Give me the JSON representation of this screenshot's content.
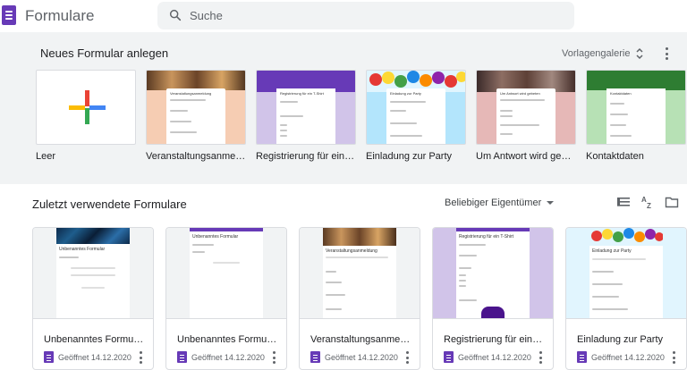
{
  "app": {
    "title": "Formulare",
    "logo_icon": "forms-logo-icon",
    "accent": "#673ab7"
  },
  "search": {
    "placeholder": "Suche"
  },
  "templates": {
    "title": "Neues Formular anlegen",
    "gallery_label": "Vorlagengalerie",
    "items": [
      {
        "label": "Leer"
      },
      {
        "label": "Veranstaltungsanmeldu...",
        "card_title": "Veranstaltungsanmeldung",
        "color": "#f6cdb3"
      },
      {
        "label": "Registrierung für ein T-...",
        "card_title": "Registrierung für ein T-Shirt",
        "color": "#673ab7"
      },
      {
        "label": "Einladung zur Party",
        "card_title": "Einladung zur Party",
        "color": "#b3e5fc"
      },
      {
        "label": "Um Antwort wird gebet...",
        "card_title": "Um Antwort wird gebeten",
        "color": "#e6b8b7"
      },
      {
        "label": "Kontaktdaten",
        "card_title": "Kontaktdaten",
        "color": "#b7e1b5"
      }
    ]
  },
  "recent": {
    "title": "Zuletzt verwendete Formulare",
    "owner_filter": "Beliebiger Eigentümer",
    "docs": [
      {
        "name": "Unbenanntes Formular",
        "meta": "Geöffnet 14.12.2020",
        "card_title": "Unbenanntes Formular"
      },
      {
        "name": "Unbenanntes Formular",
        "meta": "Geöffnet 14.12.2020",
        "card_title": "Unbenanntes Formular"
      },
      {
        "name": "Veranstaltungsanmeldung",
        "meta": "Geöffnet 14.12.2020",
        "card_title": "Veranstaltungsanmeldung"
      },
      {
        "name": "Registrierung für ein T-Sh...",
        "meta": "Geöffnet 14.12.2020",
        "card_title": "Registrierung für ein T-Shirt"
      },
      {
        "name": "Einladung zur Party",
        "meta": "Geöffnet 14.12.2020",
        "card_title": "Einladung zur Party"
      }
    ]
  }
}
